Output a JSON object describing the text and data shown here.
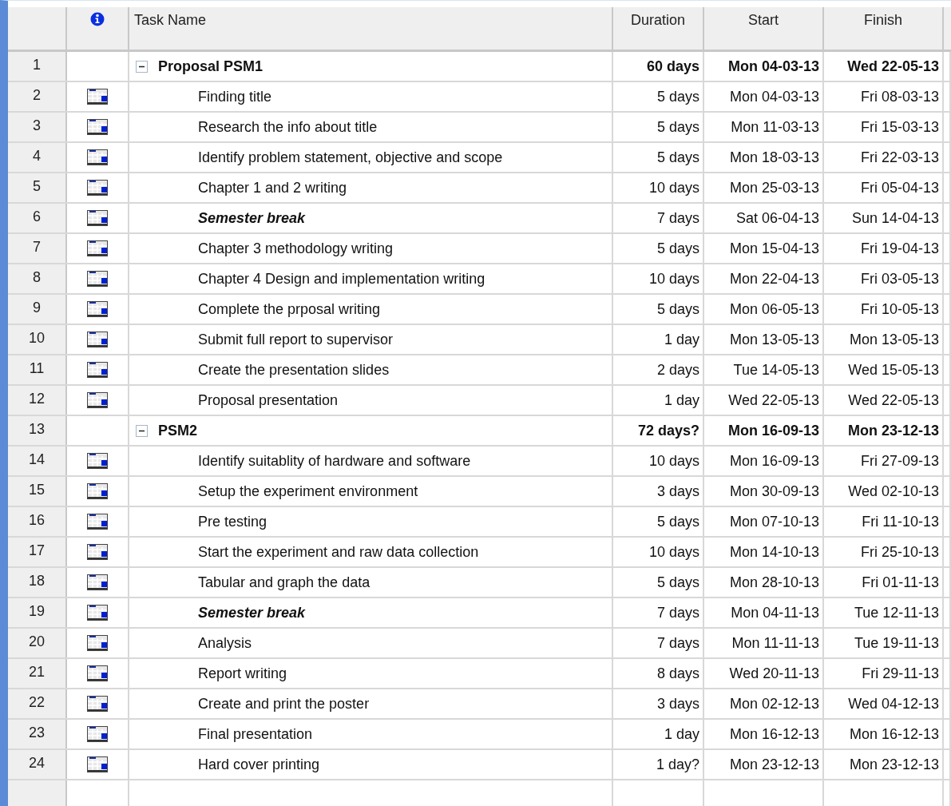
{
  "table": {
    "columns": [
      "Task Name",
      "Duration",
      "Start",
      "Finish"
    ],
    "rows": [
      {
        "id": "1",
        "kind": "summary",
        "expanded": true,
        "name": "Proposal PSM1",
        "duration": "60 days",
        "start": "Mon 04-03-13",
        "finish": "Wed 22-05-13",
        "children": [
          {
            "id": "2",
            "kind": "task",
            "italic": false,
            "name": "Finding title",
            "duration": "5 days",
            "start": "Mon 04-03-13",
            "finish": "Fri 08-03-13"
          },
          {
            "id": "3",
            "kind": "task",
            "italic": false,
            "name": "Research the info about title",
            "duration": "5 days",
            "start": "Mon 11-03-13",
            "finish": "Fri 15-03-13"
          },
          {
            "id": "4",
            "kind": "task",
            "italic": false,
            "name": "Identify problem statement, objective and scope",
            "duration": "5 days",
            "start": "Mon 18-03-13",
            "finish": "Fri 22-03-13"
          },
          {
            "id": "5",
            "kind": "task",
            "italic": false,
            "name": "Chapter 1 and 2 writing",
            "duration": "10 days",
            "start": "Mon 25-03-13",
            "finish": "Fri 05-04-13"
          },
          {
            "id": "6",
            "kind": "task",
            "italic": true,
            "name": "Semester break",
            "duration": "7 days",
            "start": "Sat 06-04-13",
            "finish": "Sun 14-04-13"
          },
          {
            "id": "7",
            "kind": "task",
            "italic": false,
            "name": "Chapter 3 methodology writing",
            "duration": "5 days",
            "start": "Mon 15-04-13",
            "finish": "Fri 19-04-13"
          },
          {
            "id": "8",
            "kind": "task",
            "italic": false,
            "name": "Chapter 4 Design and implementation writing",
            "duration": "10 days",
            "start": "Mon 22-04-13",
            "finish": "Fri 03-05-13"
          },
          {
            "id": "9",
            "kind": "task",
            "italic": false,
            "name": "Complete the prposal writing",
            "duration": "5 days",
            "start": "Mon 06-05-13",
            "finish": "Fri 10-05-13"
          },
          {
            "id": "10",
            "kind": "task",
            "italic": false,
            "name": "Submit full report to supervisor",
            "duration": "1 day",
            "start": "Mon 13-05-13",
            "finish": "Mon 13-05-13"
          },
          {
            "id": "11",
            "kind": "task",
            "italic": false,
            "name": "Create the presentation slides",
            "duration": "2 days",
            "start": "Tue 14-05-13",
            "finish": "Wed 15-05-13"
          },
          {
            "id": "12",
            "kind": "task",
            "italic": false,
            "name": "Proposal presentation",
            "duration": "1 day",
            "start": "Wed 22-05-13",
            "finish": "Wed 22-05-13"
          }
        ]
      },
      {
        "id": "13",
        "kind": "summary",
        "expanded": true,
        "name": "PSM2",
        "duration": "72 days?",
        "start": "Mon 16-09-13",
        "finish": "Mon 23-12-13",
        "children": [
          {
            "id": "14",
            "kind": "task",
            "italic": false,
            "name": "Identify suitablity of hardware and software",
            "duration": "10 days",
            "start": "Mon 16-09-13",
            "finish": "Fri 27-09-13"
          },
          {
            "id": "15",
            "kind": "task",
            "italic": false,
            "name": "Setup the experiment environment",
            "duration": "3 days",
            "start": "Mon 30-09-13",
            "finish": "Wed 02-10-13"
          },
          {
            "id": "16",
            "kind": "task",
            "italic": false,
            "name": "Pre testing",
            "duration": "5 days",
            "start": "Mon 07-10-13",
            "finish": "Fri 11-10-13"
          },
          {
            "id": "17",
            "kind": "task",
            "italic": false,
            "name": "Start the experiment and raw data collection",
            "duration": "10 days",
            "start": "Mon 14-10-13",
            "finish": "Fri 25-10-13"
          },
          {
            "id": "18",
            "kind": "task",
            "italic": false,
            "name": "Tabular and graph the data",
            "duration": "5 days",
            "start": "Mon 28-10-13",
            "finish": "Fri 01-11-13"
          },
          {
            "id": "19",
            "kind": "task",
            "italic": true,
            "name": "Semester break",
            "duration": "7 days",
            "start": "Mon 04-11-13",
            "finish": "Tue 12-11-13"
          },
          {
            "id": "20",
            "kind": "task",
            "italic": false,
            "name": "Analysis",
            "duration": "7 days",
            "start": "Mon 11-11-13",
            "finish": "Tue 19-11-13"
          },
          {
            "id": "21",
            "kind": "task",
            "italic": false,
            "name": "Report writing",
            "duration": "8 days",
            "start": "Wed 20-11-13",
            "finish": "Fri 29-11-13"
          },
          {
            "id": "22",
            "kind": "task",
            "italic": false,
            "name": "Create and print the poster",
            "duration": "3 days",
            "start": "Mon 02-12-13",
            "finish": "Wed 04-12-13"
          },
          {
            "id": "23",
            "kind": "task",
            "italic": false,
            "name": "Final presentation",
            "duration": "1 day",
            "start": "Mon 16-12-13",
            "finish": "Mon 16-12-13"
          },
          {
            "id": "24",
            "kind": "task",
            "italic": false,
            "name": "Hard cover printing",
            "duration": "1 day?",
            "start": "Mon 23-12-13",
            "finish": "Mon 23-12-13"
          }
        ]
      }
    ]
  }
}
